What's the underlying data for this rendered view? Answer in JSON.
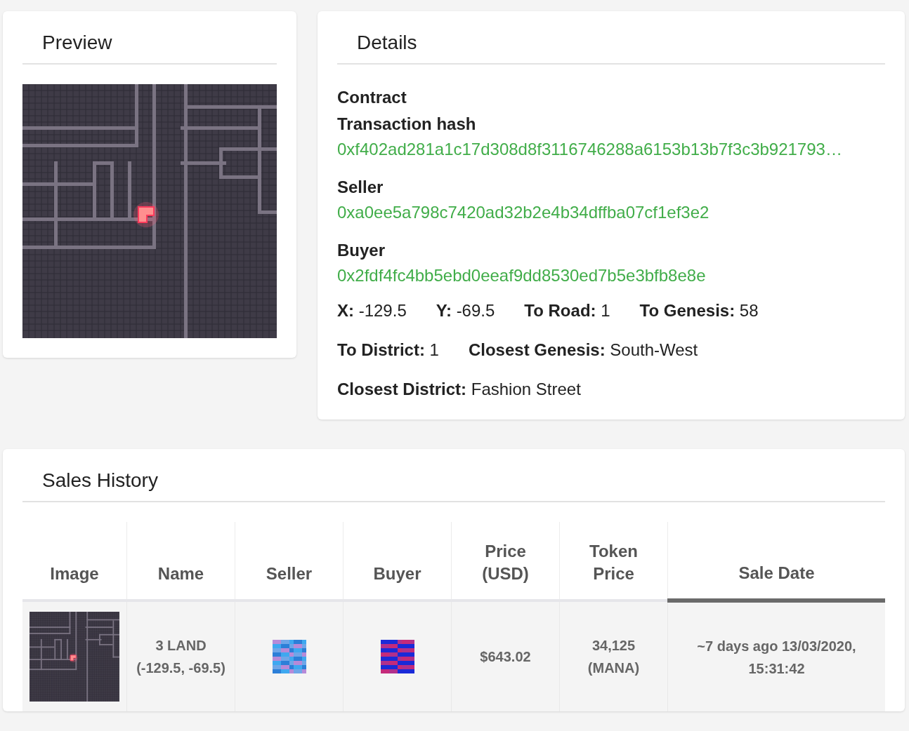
{
  "preview": {
    "title": "Preview"
  },
  "details": {
    "title": "Details",
    "blocks": [
      {
        "label": "Contract"
      },
      {
        "label": "Transaction hash",
        "value": "0xf402ad281a1c17d308d8f3116746288a6153b13b7f3c3b921793…"
      },
      {
        "label": "Seller",
        "value": "0xa0ee5a798c7420ad32b2e4b34dffba07cf1ef3e2"
      },
      {
        "label": "Buyer",
        "value": "0x2fdf4fc4bb5ebd0eeaf9dd8530ed7b5e3bfb8e8e"
      }
    ],
    "stat_rows": [
      [
        {
          "label": "X:",
          "value": "-129.5"
        },
        {
          "label": "Y:",
          "value": "-69.5"
        },
        {
          "label": "To Road:",
          "value": "1"
        },
        {
          "label": "To Genesis:",
          "value": "58"
        }
      ],
      [
        {
          "label": "To District:",
          "value": "1"
        },
        {
          "label": "Closest Genesis:",
          "value": "South-West"
        }
      ],
      [
        {
          "label": "Closest District:",
          "value": "Fashion Street"
        }
      ]
    ]
  },
  "sales_history": {
    "title": "Sales History",
    "columns": [
      {
        "label": "Image",
        "sorted": false
      },
      {
        "label": "Name",
        "sorted": false
      },
      {
        "label": "Seller",
        "sorted": false
      },
      {
        "label": "Buyer",
        "sorted": false
      },
      {
        "label": "Price (USD)",
        "sorted": false
      },
      {
        "label": "Token Price",
        "sorted": false
      },
      {
        "label": "Sale Date",
        "sorted": true
      }
    ],
    "rows": [
      {
        "name": "3 LAND (-129.5, -69.5)",
        "price_usd": "$643.02",
        "token_price": "34,125 (MANA)",
        "sale_date": "~7 days ago 13/03/2020, 15:31:42"
      }
    ]
  }
}
